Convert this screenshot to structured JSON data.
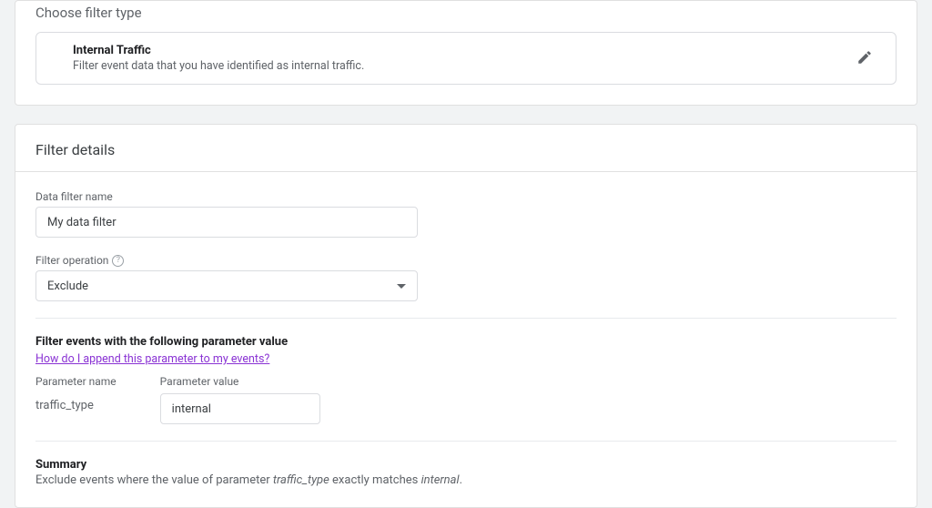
{
  "choose_section": {
    "title": "Choose filter type",
    "card": {
      "title": "Internal Traffic",
      "description": "Filter event data that you have identified as internal traffic."
    }
  },
  "details_section": {
    "title": "Filter details",
    "name_field": {
      "label": "Data filter name",
      "value": "My data filter"
    },
    "operation_field": {
      "label": "Filter operation",
      "value": "Exclude"
    },
    "events_block": {
      "heading": "Filter events with the following parameter value",
      "help_link": "How do I append this parameter to my events?",
      "param_name_label": "Parameter name",
      "param_name_value": "traffic_type",
      "param_value_label": "Parameter value",
      "param_value_value": "internal"
    },
    "summary": {
      "title": "Summary",
      "prefix": "Exclude events where the value of parameter ",
      "param": "traffic_type",
      "middle": " exactly matches ",
      "value": "internal",
      "suffix": "."
    }
  }
}
